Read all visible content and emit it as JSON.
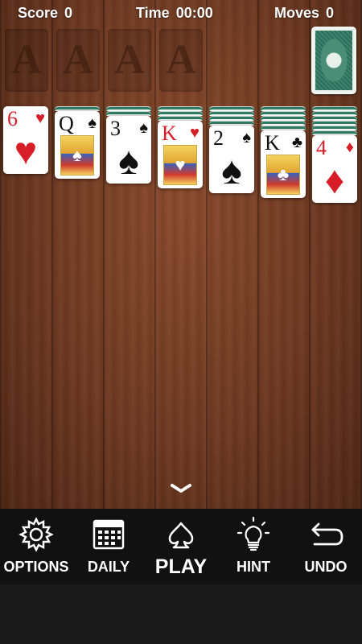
{
  "status": {
    "score_label": "Score",
    "score_value": "0",
    "time_label": "Time",
    "time_value": "00:00",
    "moves_label": "Moves",
    "moves_value": "0"
  },
  "foundations": [
    {
      "placeholder": "A"
    },
    {
      "placeholder": "A"
    },
    {
      "placeholder": "A"
    },
    {
      "placeholder": "A"
    }
  ],
  "stock": {
    "state": "face-down"
  },
  "tableau": [
    {
      "hidden_count": 0,
      "top": {
        "rank": "6",
        "suit": "♥",
        "color": "red",
        "type": "pip"
      }
    },
    {
      "hidden_count": 1,
      "top": {
        "rank": "Q",
        "suit": "♠",
        "color": "black",
        "type": "court"
      }
    },
    {
      "hidden_count": 2,
      "top": {
        "rank": "3",
        "suit": "♠",
        "color": "black",
        "type": "pip"
      }
    },
    {
      "hidden_count": 3,
      "top": {
        "rank": "K",
        "suit": "♥",
        "color": "red",
        "type": "court"
      }
    },
    {
      "hidden_count": 4,
      "top": {
        "rank": "2",
        "suit": "♠",
        "color": "black",
        "type": "pip"
      }
    },
    {
      "hidden_count": 5,
      "top": {
        "rank": "K",
        "suit": "♣",
        "color": "black",
        "type": "court"
      }
    },
    {
      "hidden_count": 6,
      "top": {
        "rank": "4",
        "suit": "♦",
        "color": "red",
        "type": "pip"
      }
    }
  ],
  "toolbar": {
    "options_label": "OPTIONS",
    "daily_label": "DAILY",
    "play_label": "PLAY",
    "hint_label": "HINT",
    "undo_label": "UNDO"
  },
  "icons": {
    "options": "gear-icon",
    "daily": "calendar-icon",
    "play": "spade-icon",
    "hint": "lightbulb-icon",
    "undo": "undo-arrow-icon",
    "expand": "chevron-down-icon"
  },
  "colors": {
    "table_wood": "#6e3820",
    "card_back": "#2d6d59",
    "red_suit": "#d71e28",
    "toolbar_bg": "#111111"
  }
}
